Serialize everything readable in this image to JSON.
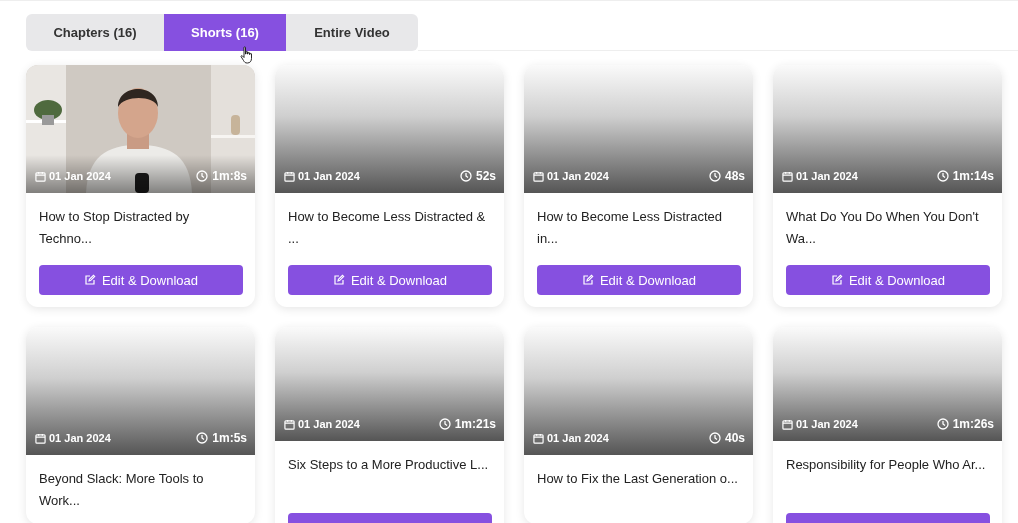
{
  "tabs": [
    {
      "label": "Chapters (16)",
      "selected": false
    },
    {
      "label": "Shorts (16)",
      "selected": true
    },
    {
      "label": "Entire Video",
      "selected": false
    }
  ],
  "cards": [
    {
      "date": "01 Jan 2024",
      "duration": "1m:8s",
      "title": "How to Stop Distracted by Techno...",
      "button": {
        "kind": "full",
        "label": "Edit & Download"
      }
    },
    {
      "thumbnail": {
        "kind": "blank"
      },
      "date": "01 Jan 2024",
      "duration": "52s",
      "title": "How to Become Less Distracted & ...",
      "button": {
        "kind": "full",
        "label": "Edit & Download"
      }
    },
    {
      "thumbnail": {
        "kind": "blank"
      },
      "date": "01 Jan 2024",
      "duration": "48s",
      "title": "How to Become Less Distracted in...",
      "button": {
        "kind": "full",
        "label": "Edit & Download"
      }
    },
    {
      "thumbnail": {
        "kind": "blank"
      },
      "date": "01 Jan 2024",
      "duration": "1m:14s",
      "title": "What Do You Do When You Don't Wa...",
      "button": {
        "kind": "full",
        "label": "Edit & Download"
      }
    },
    {
      "thumbnail": {
        "kind": "blank"
      },
      "date": "01 Jan 2024",
      "duration": "1m:5s",
      "title": "Beyond Slack: More Tools to Work..."
    },
    {
      "thumbnail": {
        "kind": "blank"
      },
      "date": "01 Jan 2024",
      "duration": "1m:21s",
      "title": "Six Steps to a More Productive L...",
      "button": {
        "kind": "cut"
      }
    },
    {
      "thumbnail": {
        "kind": "blank"
      },
      "date": "01 Jan 2024",
      "duration": "40s",
      "title": "How to Fix the Last Generation o..."
    },
    {
      "thumbnail": {
        "kind": "blank"
      },
      "date": "01 Jan 2024",
      "duration": "1m:26s",
      "title": "Responsibility for People Who Ar...",
      "button": {
        "kind": "cut"
      }
    }
  ]
}
